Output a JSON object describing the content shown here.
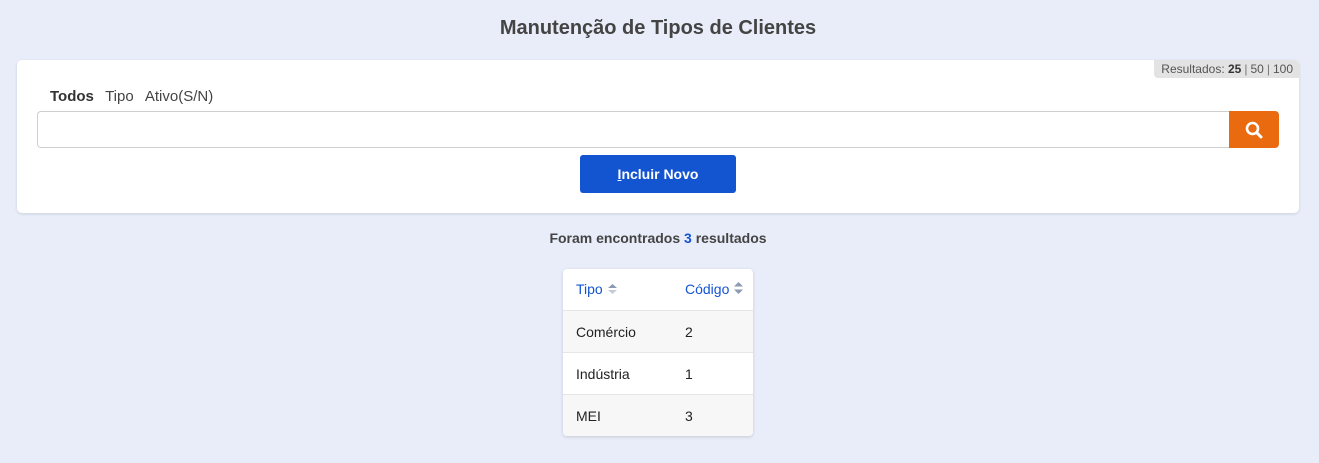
{
  "page": {
    "title": "Manutenção de Tipos de Clientes"
  },
  "pagination": {
    "label": "Resultados:",
    "options": [
      "25",
      "50",
      "100"
    ],
    "selected": "25"
  },
  "filters": {
    "tabs": [
      "Todos",
      "Tipo",
      "Ativo(S/N)"
    ],
    "active": "Todos"
  },
  "search": {
    "value": "",
    "placeholder": "",
    "button_icon": "search-icon"
  },
  "add_button": {
    "accesskey_letter": "I",
    "label_rest": "ncluir Novo"
  },
  "results": {
    "prefix": "Foram encontrados",
    "count": "3",
    "suffix": "resultados"
  },
  "table": {
    "columns": [
      "Tipo",
      "Código"
    ],
    "rows": [
      [
        "Comércio",
        "2"
      ],
      [
        "Indústria",
        "1"
      ],
      [
        "MEI",
        "3"
      ]
    ]
  },
  "colors": {
    "background": "#e8edf9",
    "accent": "#1354d1",
    "search_button": "#ea6a0f"
  }
}
